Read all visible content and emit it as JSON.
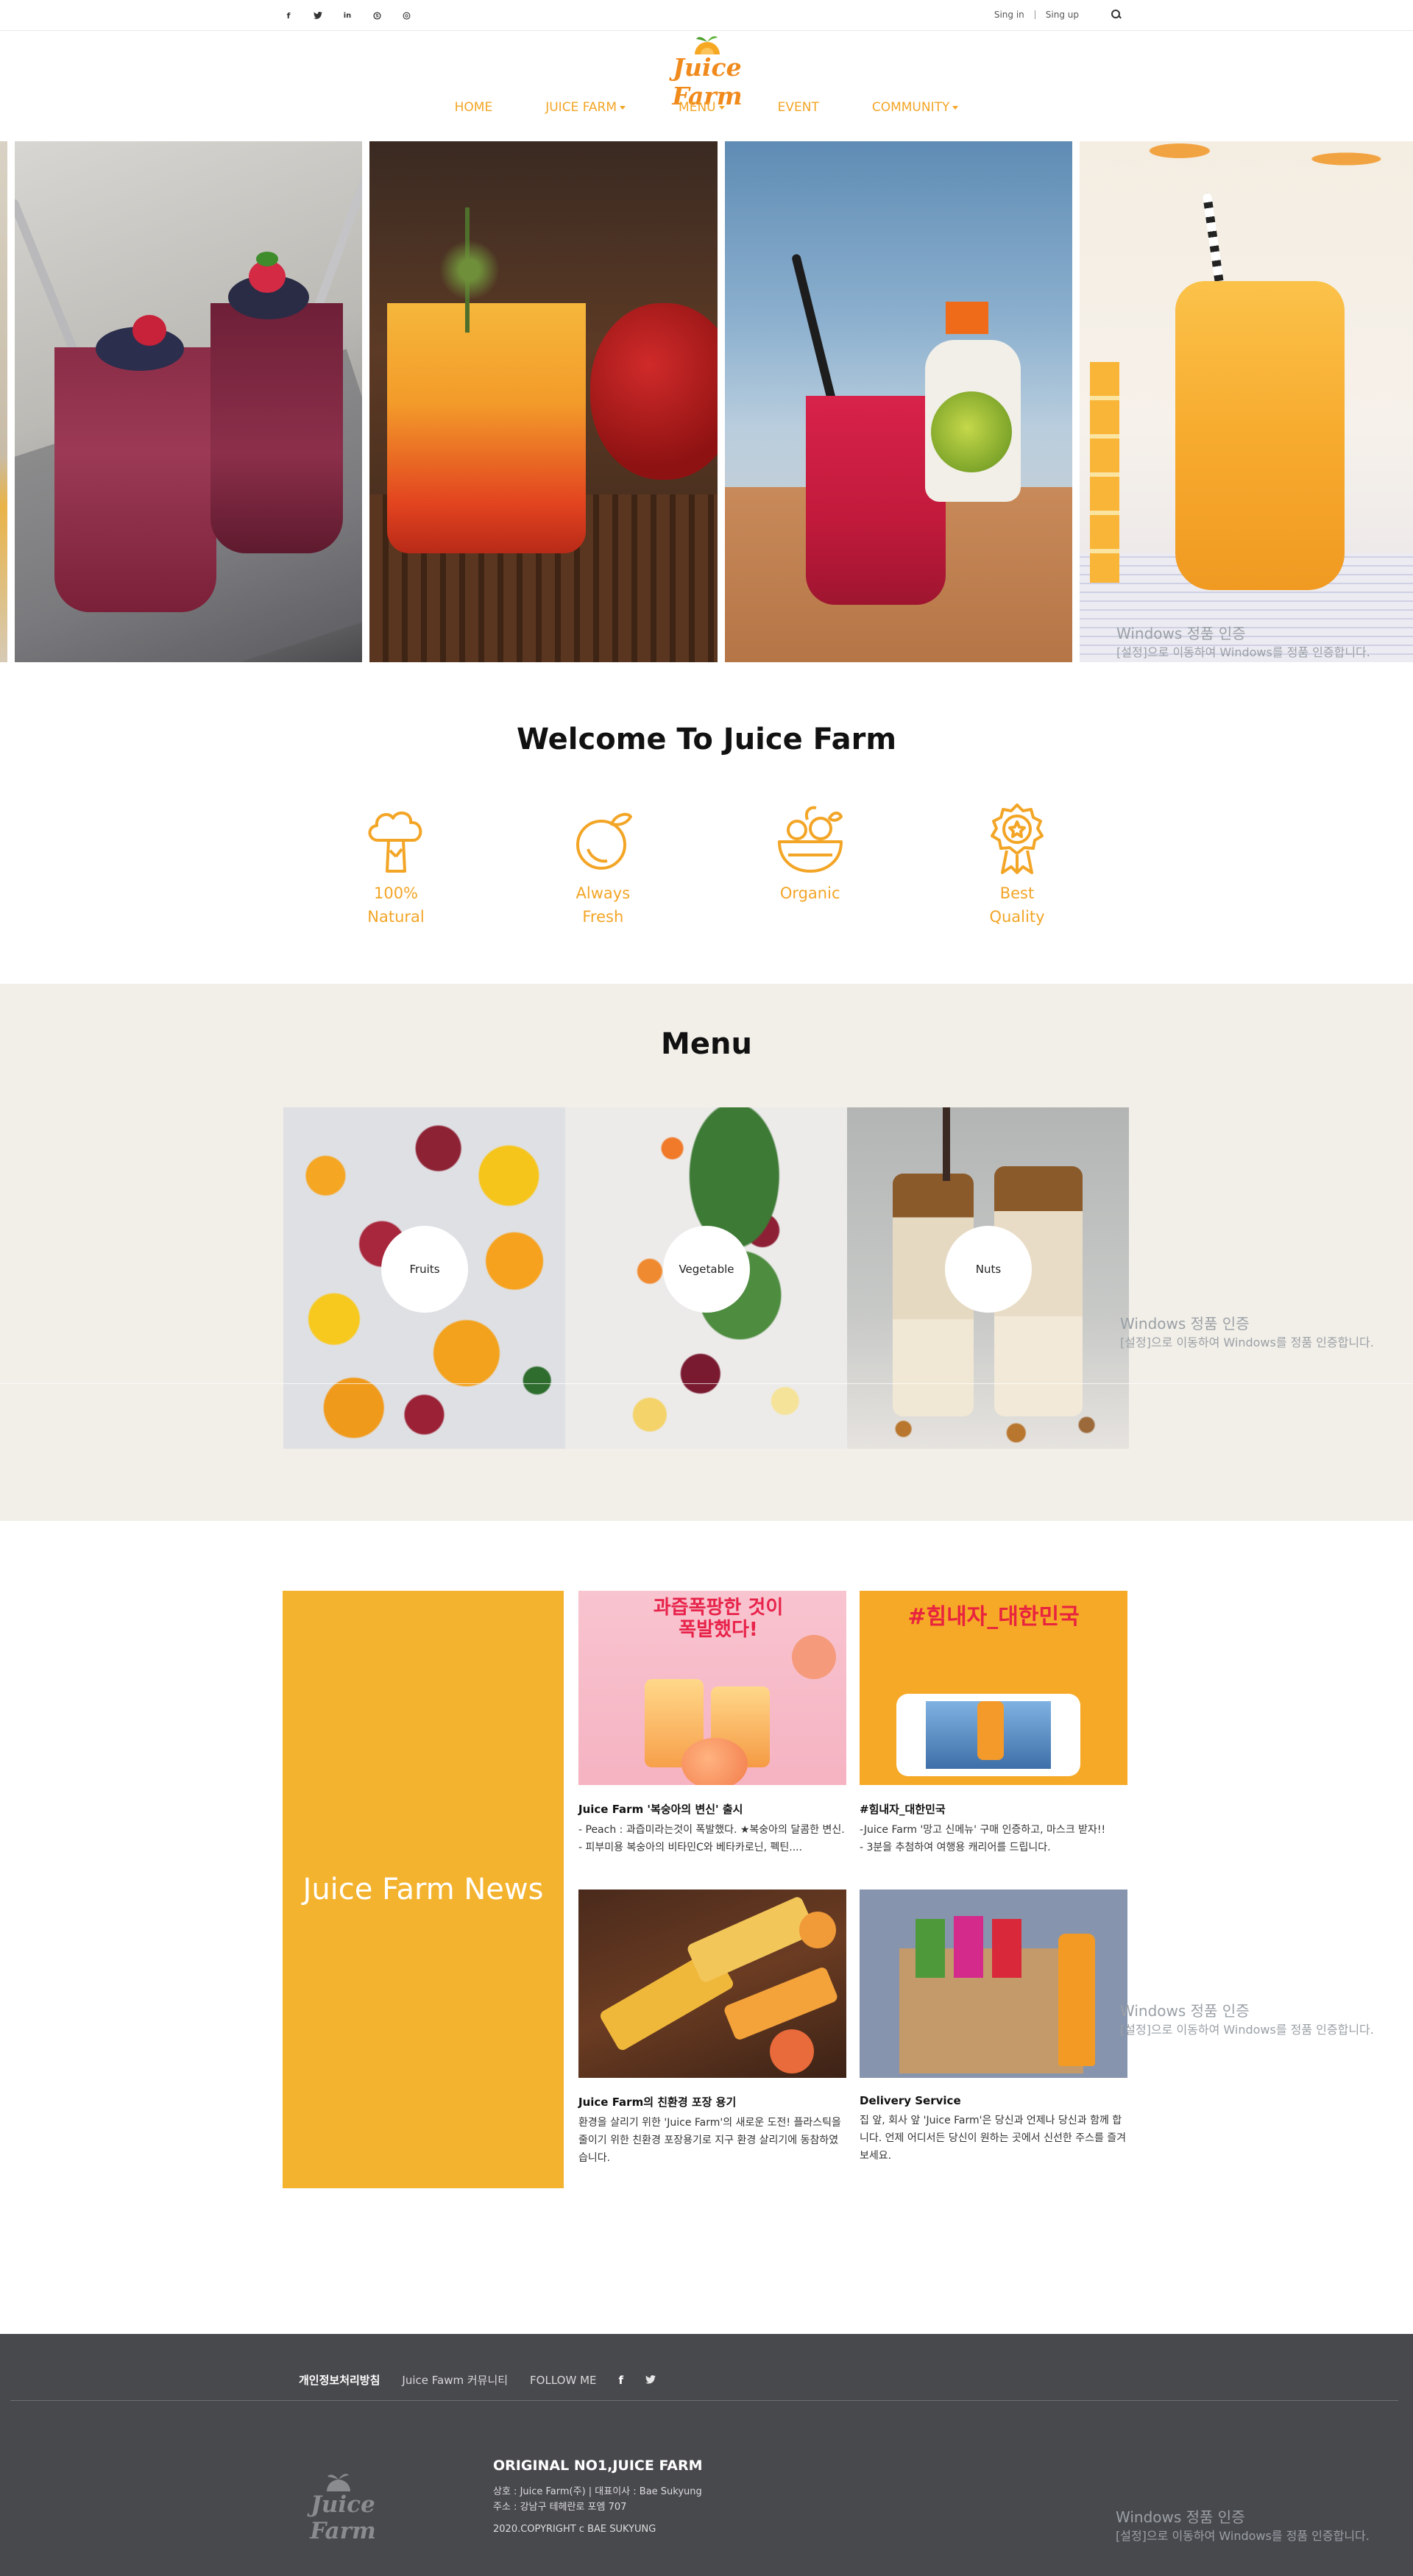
{
  "topbar": {
    "social_icons": [
      "facebook-icon",
      "twitter-icon",
      "linkedin-icon",
      "skype-icon",
      "dribbble-icon"
    ],
    "sign_in": "Sing in",
    "sign_up": "Sing up"
  },
  "brand": {
    "name": "Juice Farm",
    "color": "#f08a1c",
    "accent": "#f3a526"
  },
  "nav": {
    "items": [
      {
        "label": "HOME",
        "dropdown": false
      },
      {
        "label": "JUICE FARM",
        "dropdown": true
      },
      {
        "label": "MENU",
        "dropdown": true
      },
      {
        "label": "EVENT",
        "dropdown": false
      },
      {
        "label": "COMMUNITY",
        "dropdown": true
      }
    ]
  },
  "hero": {
    "watermark_line1": "Windows 정품 인증",
    "watermark_line2": "[설정]으로 이동하여 Windows를 정품 인증합니다."
  },
  "welcome": {
    "title": "Welcome To Juice Farm",
    "features": [
      {
        "icon": "broccoli-icon",
        "label": "100%\nNatural"
      },
      {
        "icon": "lemon-icon",
        "label": "Always\nFresh"
      },
      {
        "icon": "fruit-bowl-icon",
        "label": "Organic"
      },
      {
        "icon": "quality-badge-icon",
        "label": "Best\nQuality"
      }
    ]
  },
  "menu": {
    "title": "Menu",
    "cards": [
      {
        "label": "Fruits"
      },
      {
        "label": "Vegetable"
      },
      {
        "label": "Nuts"
      }
    ],
    "watermark_line1": "Windows 정품 인증",
    "watermark_line2": "[설정]으로 이동하여 Windows를 정품 인증합니다."
  },
  "news": {
    "panel_title": "Juice Farm News",
    "items": [
      {
        "image_text": "과즙폭팡한 것이 폭발했다!",
        "title": "Juice Farm '복숭아의 변신' 출시",
        "body": "- Peach : 과즙미라는것이 폭발했다. ★복숭아의 달콤한 변신.\n- 피부미용 복숭아의 비타민C와 베타카로닌, 펙틴...."
      },
      {
        "image_text": "#힘내자_대한민국",
        "title": "#힘내자_대한민국",
        "body": "-Juice Farm '망고 신메뉴' 구매 인증하고, 마스크 받자!!\n- 3분을 추첨하여 여행용 캐리어를 드립니다."
      },
      {
        "title": "Juice Farm의 친환경 포장 용기",
        "body": "환경을 살리기 위한 'Juice Farm'의 새로운 도전! 플라스틱을 줄이기 위한 친환경 포장용기로 지구 환경 살리기에 동참하였습니다."
      },
      {
        "title": "Delivery Service",
        "body": "집 앞, 회사 앞 'Juice Farm'은 당신과 언제나 당신과 함께 합니다. 언제 어디서든 당신이 원하는 곳에서 신선한 주스를 즐겨보세요."
      }
    ],
    "watermark_line1": "Windows 정품 인증",
    "watermark_line2": "[설정]으로 이동하여 Windows를 정품 인증합니다."
  },
  "footer": {
    "links": [
      "개인정보처리방침",
      "Juice Fawm 커뮤니티",
      "FOLLOW ME"
    ],
    "follow_icons": [
      "facebook-icon",
      "twitter-icon"
    ],
    "headline": "ORIGINAL NO1,JUICE FARM",
    "company": "상호 : Juice Farm(주) | 대표이사 : Bae Sukyung",
    "address": "주소 : 강남구 테헤란로 포엠 707",
    "copyright": "2020.COPYRIGHT c BAE SUKYUNG",
    "watermark_line1": "Windows 정품 인증",
    "watermark_line2": "[설정]으로 이동하여 Windows를 정품 인증합니다."
  }
}
